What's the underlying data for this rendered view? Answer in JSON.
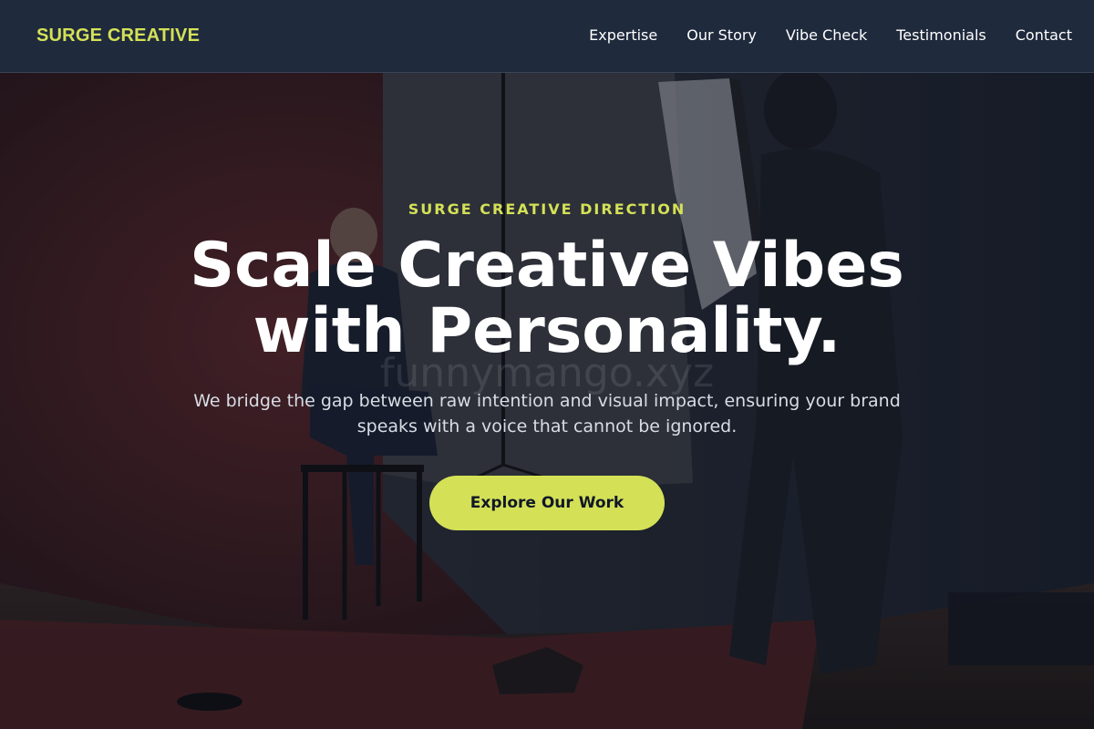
{
  "nav": {
    "brand": "SURGE CREATIVE",
    "links": [
      "Expertise",
      "Our Story",
      "Vibe Check",
      "Testimonials",
      "Contact"
    ]
  },
  "hero": {
    "background_icon": "photo-studio-background",
    "watermark": "funnymango.xyz",
    "eyebrow": "SURGE CREATIVE DIRECTION",
    "headline": "Scale Creative Vibes with Personality.",
    "subtext": "We bridge the gap between raw intention and visual impact, ensuring your brand speaks with a voice that cannot be ignored.",
    "cta_label": "Explore Our Work"
  },
  "colors": {
    "accent": "#d4e157",
    "nav_bg": "#1f2a3d",
    "text": "#ffffff"
  }
}
